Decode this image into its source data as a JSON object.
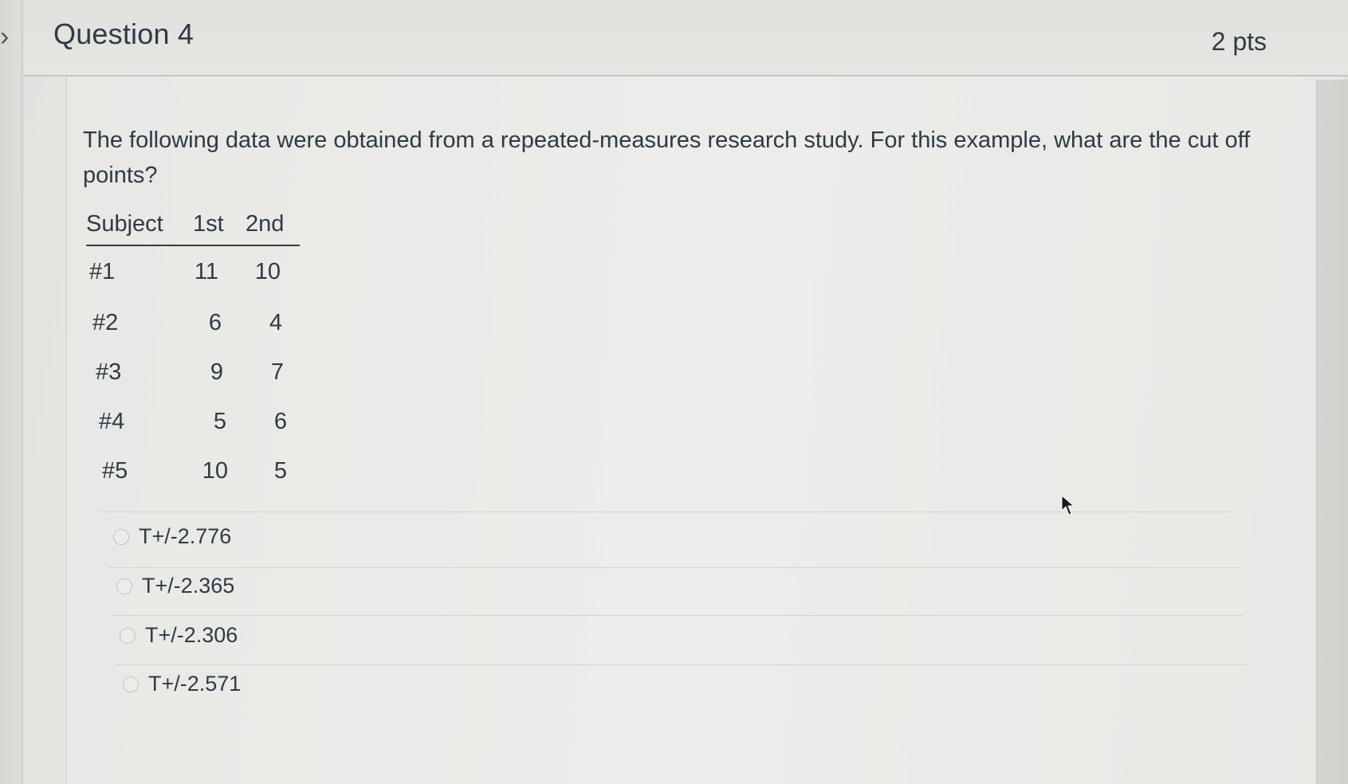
{
  "question": {
    "title": "Question 4",
    "points": "2 pts",
    "prompt": "The following data were obtained from a repeated-measures research study. For this example, what are the cut off points?"
  },
  "table": {
    "headers": [
      "Subject",
      "1st",
      "2nd"
    ],
    "rows": [
      {
        "subject": "#1",
        "first": "11",
        "second": "10"
      },
      {
        "subject": "#2",
        "first": "6",
        "second": "4"
      },
      {
        "subject": "#3",
        "first": "9",
        "second": "7"
      },
      {
        "subject": "#4",
        "first": "5",
        "second": "6"
      },
      {
        "subject": "#5",
        "first": "10",
        "second": "5"
      }
    ]
  },
  "answers": [
    {
      "label": "T+/-2.776"
    },
    {
      "label": "T+/-2.365"
    },
    {
      "label": "T+/-2.306"
    },
    {
      "label": "T+/-2.571"
    }
  ],
  "icons": {
    "collapse": "chevron-right-icon",
    "cursor": "mouse-pointer-icon"
  }
}
